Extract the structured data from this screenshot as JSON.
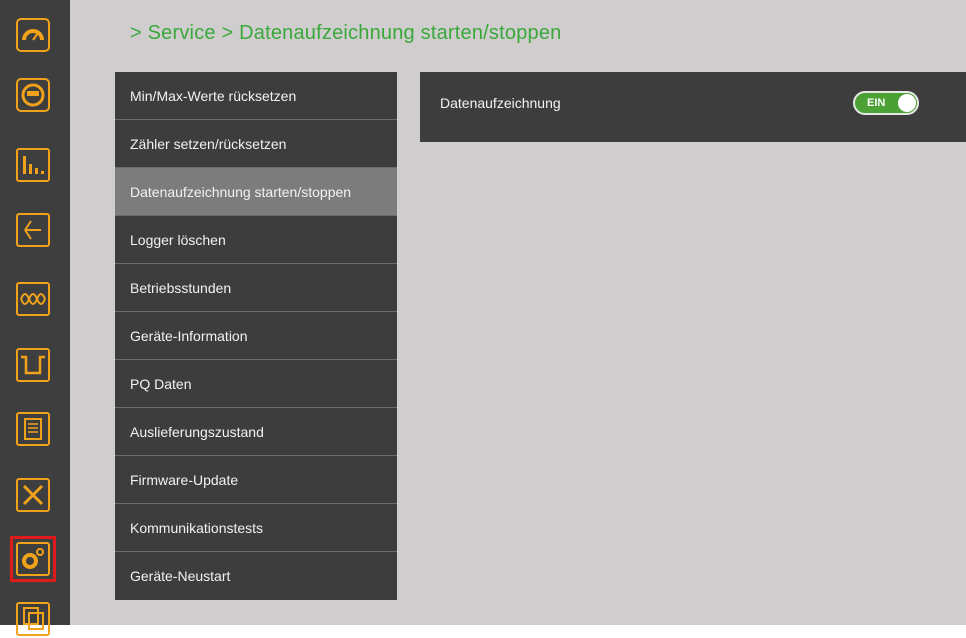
{
  "breadcrumb": "> Service > Datenaufzeichnung starten/stoppen",
  "rail": {
    "items": [
      {
        "icon": "gauge-icon"
      },
      {
        "icon": "meter-icon"
      },
      {
        "icon": "bar-chart-icon"
      },
      {
        "icon": "phasor-icon"
      },
      {
        "icon": "waveform-icon"
      },
      {
        "icon": "pulse-icon"
      },
      {
        "icon": "list-icon"
      },
      {
        "icon": "tools-icon"
      },
      {
        "icon": "settings-gears-icon",
        "active": true
      },
      {
        "icon": "copy-icon"
      }
    ],
    "active_outline_color": "#e01b1b",
    "icon_color": "#f0a21b"
  },
  "menu": {
    "items": [
      {
        "label": "Min/Max-Werte rücksetzen"
      },
      {
        "label": "Zähler setzen/rücksetzen"
      },
      {
        "label": "Datenaufzeichnung starten/stoppen",
        "selected": true
      },
      {
        "label": "Logger löschen"
      },
      {
        "label": "Betriebsstunden"
      },
      {
        "label": "Geräte-Information"
      },
      {
        "label": "PQ Daten"
      },
      {
        "label": "Auslieferungszustand"
      },
      {
        "label": "Firmware-Update"
      },
      {
        "label": "Kommunikationstests"
      },
      {
        "label": "Geräte-Neustart"
      }
    ]
  },
  "panel": {
    "label": "Datenaufzeichnung",
    "toggle": {
      "text": "EIN",
      "state": "on",
      "color": "#4ba133"
    }
  }
}
